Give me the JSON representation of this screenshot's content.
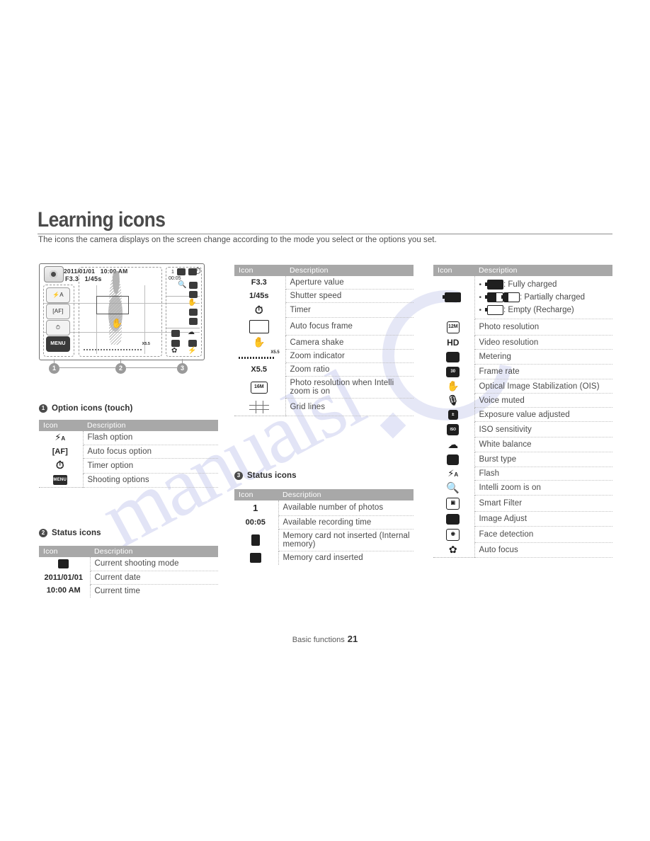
{
  "page": {
    "title": "Learning icons",
    "intro": "The icons the camera displays on the screen change according to the mode you select or the options you set.",
    "footer_section": "Basic functions",
    "footer_page": "21"
  },
  "diagram": {
    "date": "2011/01/01",
    "time": "10:00 AM",
    "aperture": "F3.3",
    "shutter": "1/45s",
    "zoom_label": "X5.5",
    "option_buttons": [
      "flash-icon",
      "AF",
      "timer-icon",
      "MENU"
    ],
    "status_count": "1",
    "status_rectime": "00:05",
    "callouts": [
      "1",
      "2",
      "3"
    ]
  },
  "sections": {
    "option_icons": {
      "number": "1",
      "heading": "Option icons (touch)",
      "columns": {
        "icon": "Icon",
        "description": "Description"
      },
      "rows": [
        {
          "icon": "flash-option-icon",
          "icon_text": "",
          "description": "Flash option"
        },
        {
          "icon": "auto-focus-option-icon",
          "icon_text": "AF",
          "description": "Auto focus option"
        },
        {
          "icon": "timer-option-icon",
          "icon_text": "",
          "description": "Timer option"
        },
        {
          "icon": "shooting-options-icon",
          "icon_text": "MENU",
          "description": "Shooting options"
        }
      ]
    },
    "status_icons_2": {
      "number": "2",
      "heading": "Status icons",
      "columns": {
        "icon": "Icon",
        "description": "Description"
      },
      "rows": [
        {
          "icon": "shooting-mode-icon",
          "icon_text": "",
          "description": "Current shooting mode"
        },
        {
          "icon": "date-text",
          "icon_text": "2011/01/01",
          "description": "Current date"
        },
        {
          "icon": "time-text",
          "icon_text": "10:00 AM",
          "description": "Current time"
        }
      ]
    },
    "shooting_info": {
      "columns": {
        "icon": "Icon",
        "description": "Description"
      },
      "rows": [
        {
          "icon": "aperture-text",
          "icon_text": "F3.3",
          "description": "Aperture value"
        },
        {
          "icon": "shutter-text",
          "icon_text": "1/45s",
          "description": "Shutter speed"
        },
        {
          "icon": "timer-icon",
          "icon_text": "",
          "description": "Timer"
        },
        {
          "icon": "auto-focus-frame-icon",
          "icon_text": "",
          "description": "Auto focus frame"
        },
        {
          "icon": "camera-shake-icon",
          "icon_text": "",
          "description": "Camera shake"
        },
        {
          "icon": "zoom-indicator-icon",
          "icon_text": "X5.5",
          "description": "Zoom indicator"
        },
        {
          "icon": "zoom-ratio-text",
          "icon_text": "X5.5",
          "description": "Zoom ratio"
        },
        {
          "icon": "intelli-resolution-icon",
          "icon_text": "16M",
          "description": "Photo resolution when Intelli zoom is on"
        },
        {
          "icon": "grid-lines-icon",
          "icon_text": "",
          "description": "Grid lines"
        }
      ]
    },
    "status_icons_3": {
      "number": "3",
      "heading": "Status icons",
      "columns": {
        "icon": "Icon",
        "description": "Description"
      },
      "rows": [
        {
          "icon": "photo-count-text",
          "icon_text": "1",
          "description": "Available number of photos"
        },
        {
          "icon": "recording-time-text",
          "icon_text": "00:05",
          "description": "Available recording time"
        },
        {
          "icon": "internal-memory-icon",
          "icon_text": "",
          "description": "Memory card not inserted (Internal memory)"
        },
        {
          "icon": "memory-card-icon",
          "icon_text": "",
          "description": "Memory card inserted"
        }
      ]
    },
    "status_icons_right": {
      "columns": {
        "icon": "Icon",
        "description": "Description"
      },
      "battery": {
        "icon": "battery-icon",
        "lines": [
          ": Fully charged",
          ": Partially charged",
          ": Empty (Recharge)"
        ]
      },
      "rows": [
        {
          "icon": "photo-resolution-icon",
          "icon_text": "12M",
          "description": "Photo resolution"
        },
        {
          "icon": "video-resolution-icon",
          "icon_text": "HD",
          "description": "Video resolution"
        },
        {
          "icon": "metering-icon",
          "icon_text": "",
          "description": "Metering"
        },
        {
          "icon": "frame-rate-icon",
          "icon_text": "30",
          "description": "Frame rate"
        },
        {
          "icon": "ois-icon",
          "icon_text": "",
          "description": "Optical Image Stabilization (OIS)"
        },
        {
          "icon": "voice-muted-icon",
          "icon_text": "",
          "description": "Voice muted"
        },
        {
          "icon": "exposure-value-icon",
          "icon_text": "",
          "description": "Exposure value adjusted"
        },
        {
          "icon": "iso-sensitivity-icon",
          "icon_text": "ISO",
          "description": "ISO sensitivity"
        },
        {
          "icon": "white-balance-icon",
          "icon_text": "",
          "description": "White balance"
        },
        {
          "icon": "burst-type-icon",
          "icon_text": "",
          "description": "Burst type"
        },
        {
          "icon": "flash-icon",
          "icon_text": "",
          "description": "Flash"
        },
        {
          "icon": "intelli-zoom-icon",
          "icon_text": "",
          "description": "Intelli zoom is on"
        },
        {
          "icon": "smart-filter-icon",
          "icon_text": "",
          "description": "Smart Filter"
        },
        {
          "icon": "image-adjust-icon",
          "icon_text": "",
          "description": "Image Adjust"
        },
        {
          "icon": "face-detection-icon",
          "icon_text": "",
          "description": "Face detection"
        },
        {
          "icon": "auto-focus-icon",
          "icon_text": "",
          "description": "Auto focus"
        }
      ]
    }
  },
  "watermark": {
    "text": "manualsl"
  }
}
